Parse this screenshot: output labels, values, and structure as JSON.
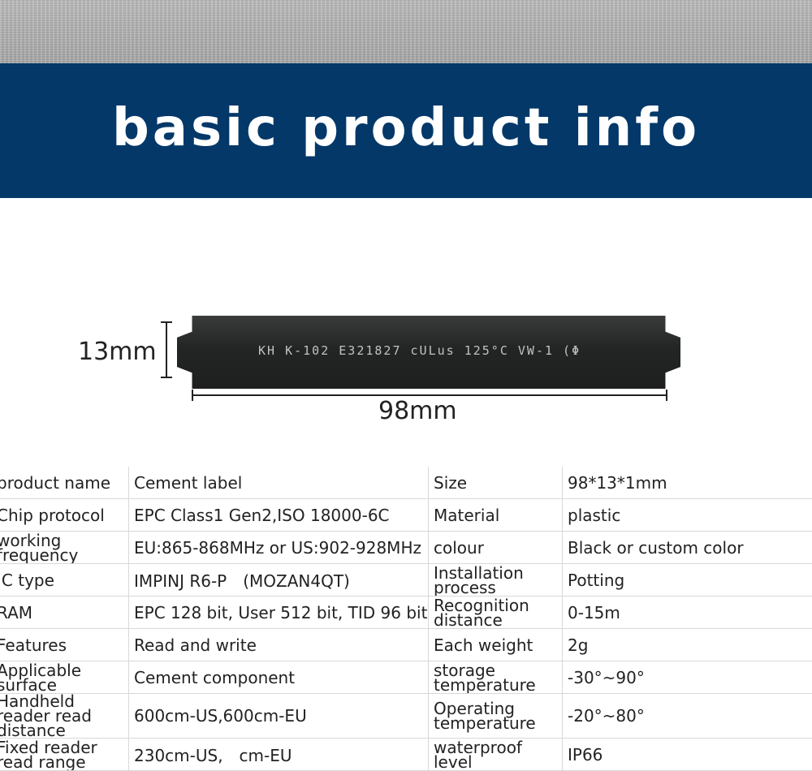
{
  "banner": {
    "title": "basic product info"
  },
  "figure": {
    "printed_text": "KH  K-102  E321827  cULus  125°C  VW-1  (Φ",
    "height_label": "13mm",
    "width_label": "98mm"
  },
  "table": {
    "rows": [
      [
        "product name",
        "Cement label",
        "Size",
        "98*13*1mm"
      ],
      [
        "Chip protocol",
        "EPC Class1 Gen2,ISO 18000-6C",
        "Material",
        "plastic"
      ],
      [
        "working frequency",
        "EU:865-868MHz or US:902-928MHz",
        "colour",
        "Black or custom color"
      ],
      [
        "IC type",
        "IMPINJ R6-P　(MOZAN4QT)",
        "Installation process",
        "Potting"
      ],
      [
        "RAM",
        "EPC 128 bit, User 512 bit, TID 96 bit",
        "Recognition distance",
        "0-15m"
      ],
      [
        "Features",
        "Read and write",
        "Each weight",
        "2g"
      ],
      [
        "Applicable surface",
        "Cement component",
        "storage temperature",
        "-30°~90°"
      ],
      [
        "Handheld reader read distance",
        "600cm-US,600cm-EU",
        "Operating temperature",
        "-20°~80°"
      ],
      [
        "Fixed reader read range",
        "230cm-US,　cm-EU",
        "waterproof level",
        "IP66"
      ]
    ]
  }
}
